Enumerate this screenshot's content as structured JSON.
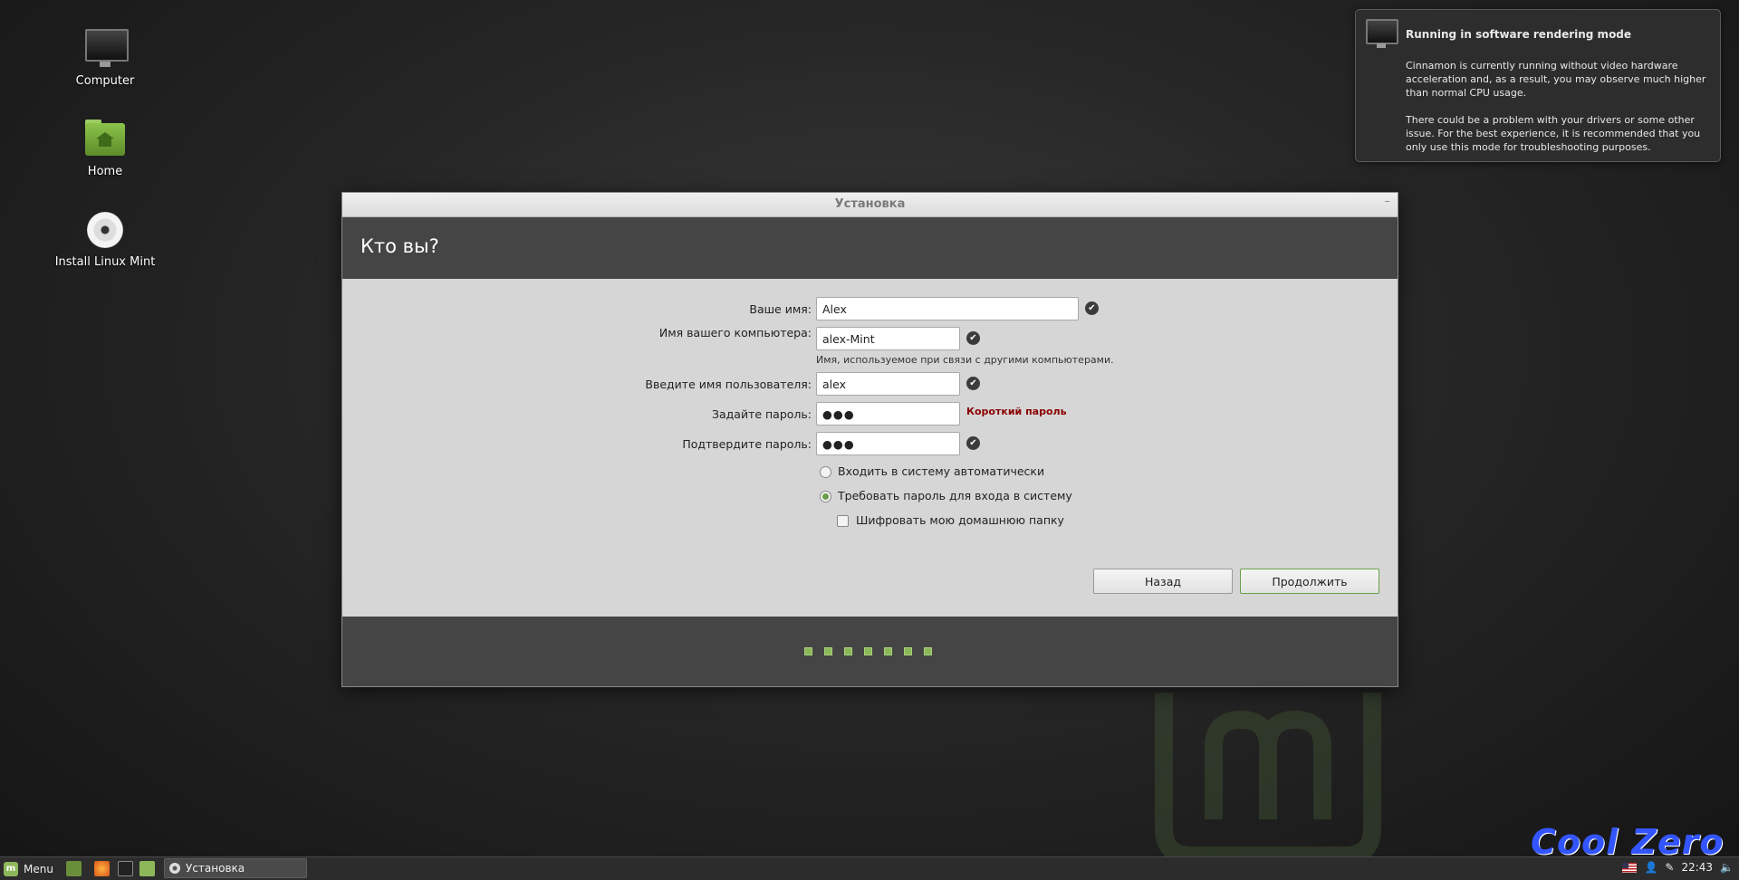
{
  "desktop": {
    "icons": [
      {
        "label": "Computer"
      },
      {
        "label": "Home"
      },
      {
        "label": "Install Linux Mint"
      }
    ]
  },
  "notification": {
    "title": "Running in software rendering mode",
    "body": "Cinnamon is currently running without video hardware acceleration and, as a result, you may observe much higher than normal CPU usage.\n\nThere could be a problem with your drivers or some other issue.  For the best experience, it is recommended that you only use this mode for troubleshooting purposes."
  },
  "window": {
    "title": "Установка",
    "minimize": "–",
    "heading": "Кто вы?",
    "form": {
      "name_label": "Ваше имя:",
      "name_value": "Alex",
      "computer_label": "Имя вашего компьютера:",
      "computer_value": "alex-Mint",
      "computer_hint": "Имя, используемое при связи с другими компьютерами.",
      "username_label": "Введите имя пользователя:",
      "username_value": "alex",
      "password_label": "Задайте пароль:",
      "password_value": "●●●",
      "password_warning": "Короткий пароль",
      "confirm_label": "Подтвердите пароль:",
      "confirm_value": "●●●",
      "auto_login": "Входить в систему автоматически",
      "require_password": "Требовать пароль для входа в систему",
      "encrypt_home": "Шифровать мою домашнюю папку"
    },
    "buttons": {
      "back": "Назад",
      "continue": "Продолжить"
    },
    "progress_steps": 7
  },
  "taskbar": {
    "menu_label": "Menu",
    "window_button": "Установка",
    "clock": "22:43"
  },
  "watermark": "Cool Zero",
  "colors": {
    "accent": "#8cb85a",
    "warning": "#8b0000",
    "header_bg": "#454545"
  }
}
